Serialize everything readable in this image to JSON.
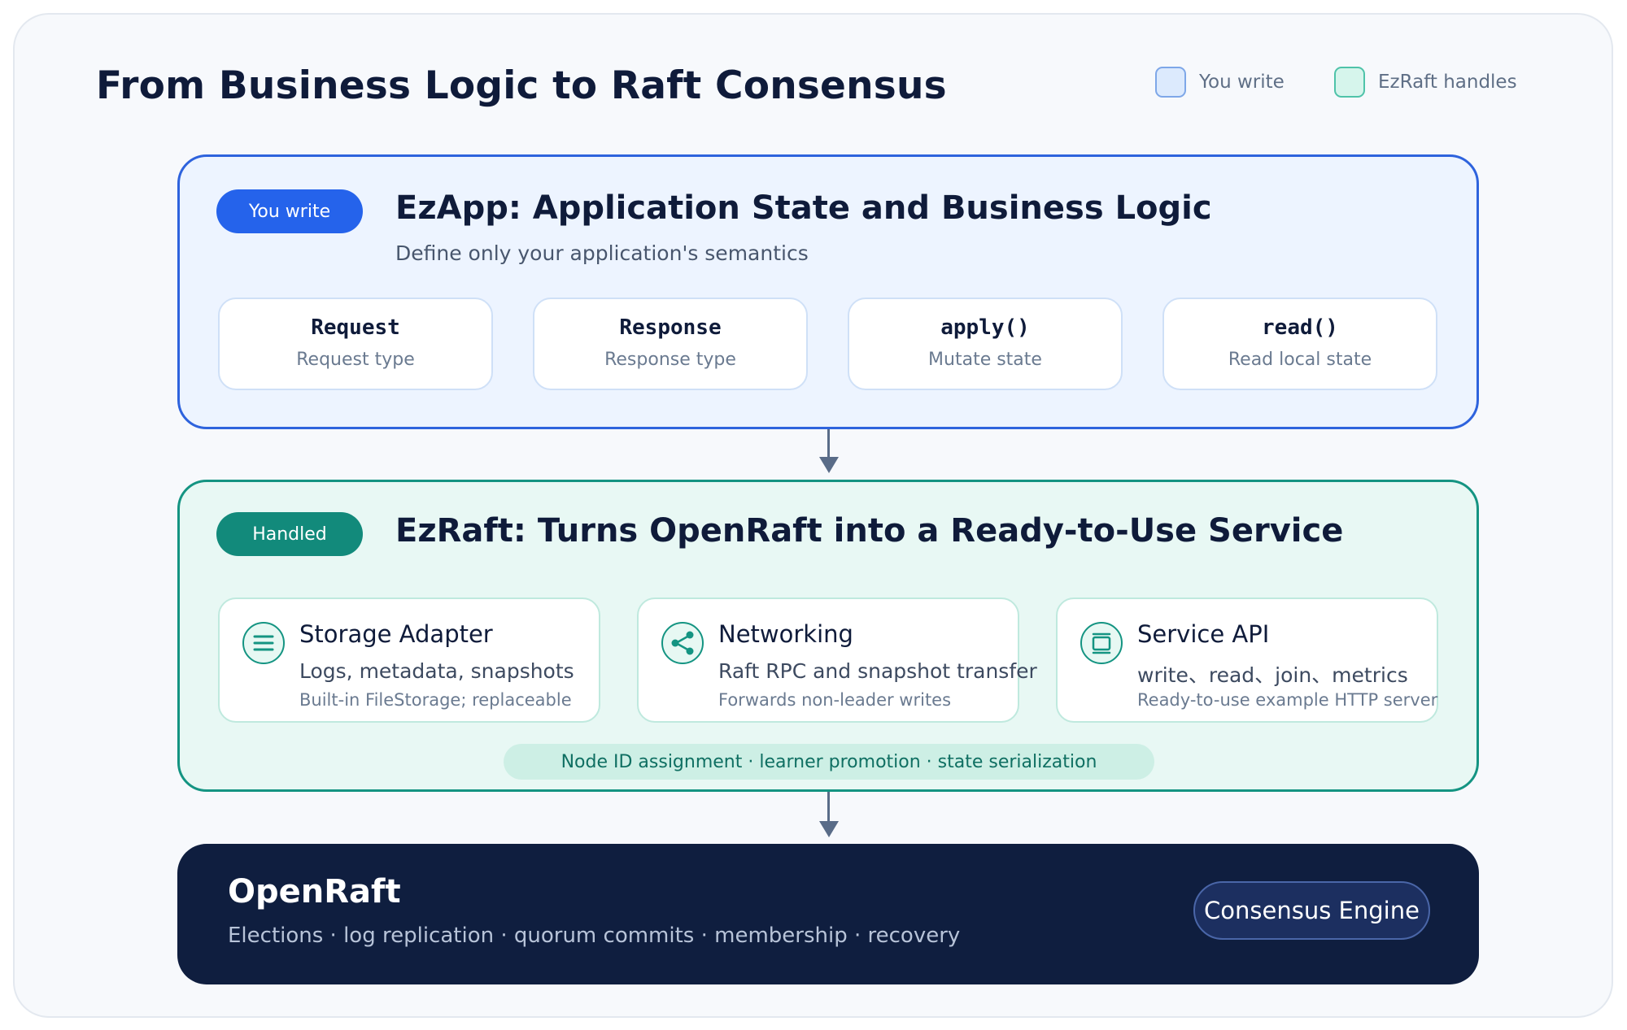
{
  "title": "From Business Logic to Raft Consensus",
  "legend": [
    {
      "label": "You write",
      "color": "#dceafd",
      "border": "#7ea7e8"
    },
    {
      "label": "EzRaft handles",
      "color": "#d6f5ec",
      "border": "#4fc3a9"
    }
  ],
  "app": {
    "pill": "You write",
    "title": "EzApp: Application State and Business Logic",
    "subtitle": "Define only your application's semantics",
    "cards": [
      {
        "name": "Request",
        "desc": "Request type"
      },
      {
        "name": "Response",
        "desc": "Response type"
      },
      {
        "name": "apply()",
        "desc": "Mutate state"
      },
      {
        "name": "read()",
        "desc": "Read local state"
      }
    ]
  },
  "ezraft": {
    "pill": "Handled",
    "title": "EzRaft: Turns OpenRaft into a Ready-to-Use Service",
    "cards": [
      {
        "icon": "list-icon",
        "title": "Storage Adapter",
        "desc": "Logs, metadata, snapshots",
        "note": "Built-in FileStorage; replaceable"
      },
      {
        "icon": "share-icon",
        "title": "Networking",
        "desc": "Raft RPC and snapshot transfer",
        "note": "Forwards non-leader writes"
      },
      {
        "icon": "monitor-icon",
        "title": "Service API",
        "desc": "write、read、join、metrics",
        "note": "Ready-to-use example HTTP server"
      }
    ],
    "ribbon": "Node ID assignment · learner promotion · state serialization"
  },
  "openraft": {
    "title": "OpenRaft",
    "subtitle": "Elections · log replication · quorum commits · membership · recovery",
    "badge": "Consensus Engine"
  },
  "colors": {
    "blue_accent": "#2563eb",
    "teal_accent": "#128a7b",
    "dark_panel": "#0f1e3f"
  }
}
